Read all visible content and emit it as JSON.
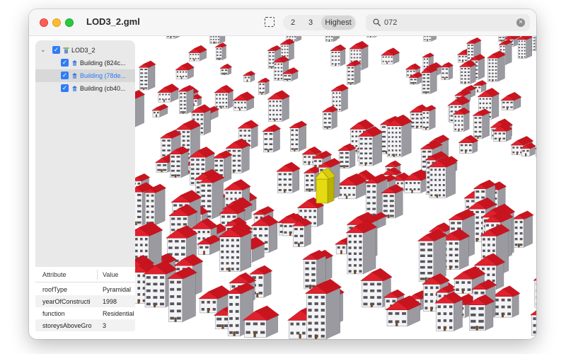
{
  "window": {
    "title": "LOD3_2.gml"
  },
  "toolbar": {
    "selection_icon": "dashed-selection-icon",
    "lod_options": [
      "2",
      "3",
      "Highest"
    ],
    "lod_selected": "Highest",
    "search_value": "072",
    "search_icon": "magnifier-icon",
    "clear_icon": "clear-x-icon"
  },
  "tree": {
    "root": {
      "label": "LOD3_2",
      "expanded": true,
      "checked": true
    },
    "children": [
      {
        "label": "Building (824c...",
        "checked": true,
        "selected": false
      },
      {
        "label": "Building (78de...",
        "checked": true,
        "selected": true
      },
      {
        "label": "Building (cb40...",
        "checked": true,
        "selected": false
      }
    ]
  },
  "attributes": {
    "col_attribute": "Attribute",
    "col_value": "Value",
    "rows": [
      {
        "key": "roofType",
        "value": "Pyramidal"
      },
      {
        "key": "yearOfConstructi",
        "value": "1998"
      },
      {
        "key": "function",
        "value": "Residential"
      },
      {
        "key": "storeysAboveGro",
        "value": "3"
      }
    ]
  },
  "scene": {
    "roof_color": "#e0202c",
    "wall_color": "#f4f4f6",
    "wall_shade_color": "#9a9aa0",
    "highlight_color": "#e4dc10",
    "highlighted_building": "Building (78de...",
    "building_count_visible": 200
  },
  "colors": {
    "accent": "#2f7df6",
    "selected_text": "#2a7bf5"
  }
}
